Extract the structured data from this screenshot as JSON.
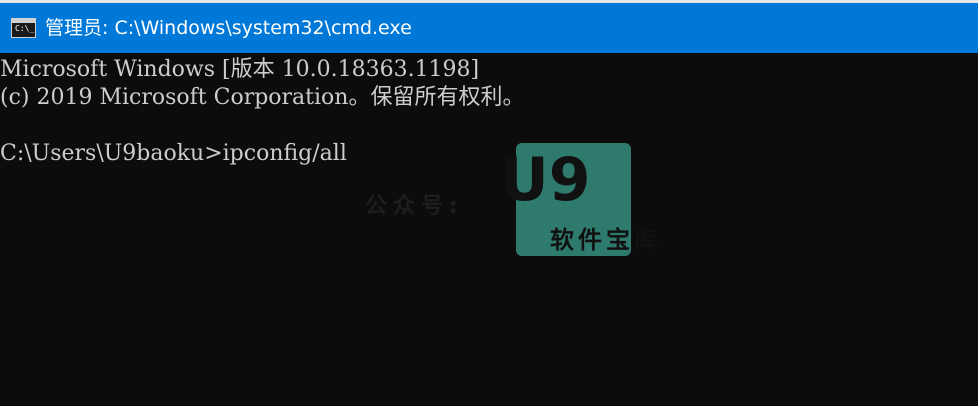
{
  "window": {
    "title": "管理员: C:\\Windows\\system32\\cmd.exe",
    "icon_text": "C:\\_",
    "icon": "cmd-icon"
  },
  "console": {
    "lines": [
      "Microsoft Windows [版本 10.0.18363.1198]",
      "(c) 2019 Microsoft Corporation。保留所有权利。",
      "",
      "C:\\Users\\U9baoku>ipconfig/all"
    ]
  },
  "watermark": {
    "label": "公众号:",
    "logo_big": "U9",
    "logo_sub": "软件宝库"
  },
  "colors": {
    "titlebar": "#0078d7",
    "background": "#0c0c0c",
    "text": "#cccccc",
    "logo": "#2e7a6d"
  }
}
